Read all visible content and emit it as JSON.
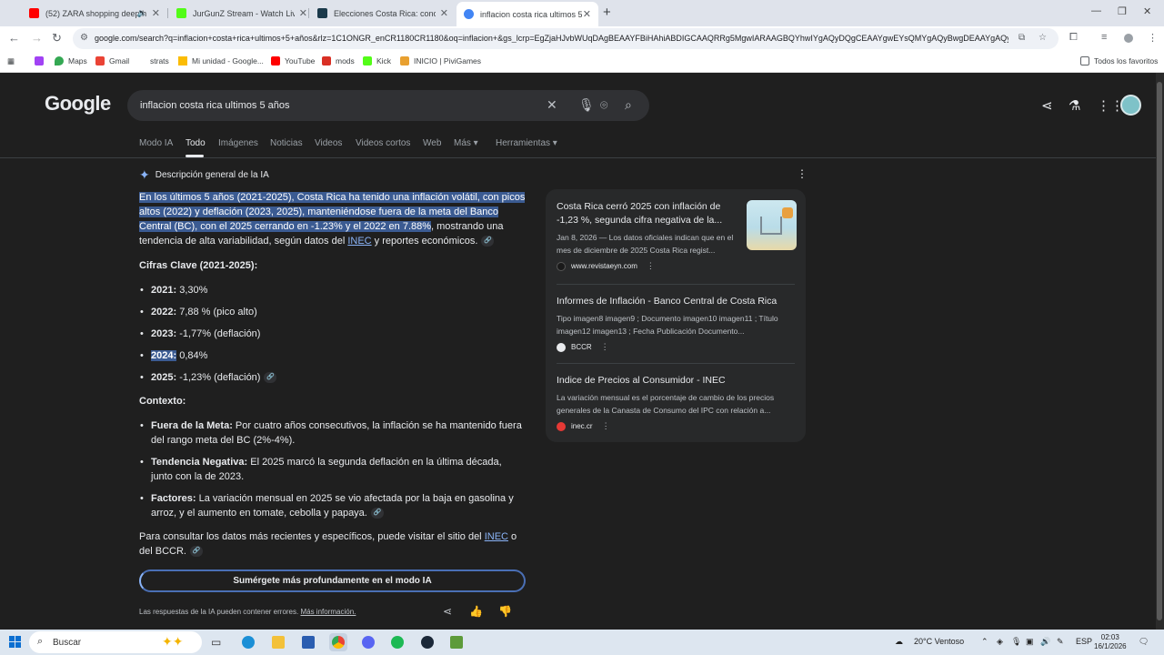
{
  "browser": {
    "tabs": [
      {
        "title": "(52) ZARA shopping deep h",
        "color": "#ff0000"
      },
      {
        "title": "JurGunZ Stream - Watch Live o",
        "color": "#53fc18"
      },
      {
        "title": "Elecciones Costa Rica: conozca",
        "color": "#1b3a4b"
      },
      {
        "title": "inflacion costa rica ultimos 5 añ",
        "color": "#4285f4"
      }
    ],
    "url": "google.com/search?q=inflacion+costa+rica+ultimos+5+años&rlz=1C1ONGR_enCR1180CR1180&oq=inflacion+&gs_lcrp=EgZjaHJvbWUqDAgBEAAYFBiHAhiABDIGCAAQRRg5MgwIARAAGBQYhwIYgAQyDQgCEAAYgwEYsQMYgAQyBwgDEAAYgAQyBwgEEAAYgAQyBwgFEAAY",
    "bookmarks": [
      "Maps",
      "Gmail",
      "strats",
      "Mi unidad - Google...",
      "YouTube",
      "mods",
      "Kick",
      "INICIO | PiviGames"
    ],
    "favorites_label": "Todos los favoritos"
  },
  "google": {
    "logo": "Google",
    "query": "inflacion costa rica ultimos 5 años",
    "tabs": [
      "Modo IA",
      "Todo",
      "Imágenes",
      "Noticias",
      "Videos",
      "Videos cortos",
      "Web",
      "Más ▾",
      "Herramientas ▾"
    ],
    "active_tab": "Todo"
  },
  "ai_overview": {
    "header": "Descripción general de la IA",
    "intro_highlight": "En los últimos 5 años (2021-2025), Costa Rica ha tenido una inflación volátil, con picos altos (2022) y deflación (2023, 2025), manteniéndose fuera de la meta del Banco Central (BC), con el 2025 cerrando en -1.23% y el 2022 en 7.88%",
    "intro_rest_1": ", mostrando una tendencia de alta variabilidad, según datos del ",
    "inec_link": "INEC",
    "intro_rest_2": " y reportes económicos.",
    "figures_title": "Cifras Clave (2021-2025):",
    "figures": [
      {
        "year": "2021:",
        "value": " 3,30%"
      },
      {
        "year": "2022:",
        "value": " 7,88 % (pico alto)"
      },
      {
        "year": "2023:",
        "value": " -1,77% (deflación)"
      },
      {
        "year": "2024:",
        "value": " 0,84%"
      },
      {
        "year": "2025:",
        "value": " -1,23% (deflación)"
      }
    ],
    "context_title": "Contexto:",
    "context": [
      {
        "label": "Fuera de la Meta:",
        "text": " Por cuatro años consecutivos, la inflación se ha mantenido fuera del rango meta del BC (2%-4%)."
      },
      {
        "label": "Tendencia Negativa:",
        "text": " El 2025 marcó la segunda deflación en la última década, junto con la de 2023."
      },
      {
        "label": "Factores:",
        "text": " La variación mensual en 2025 se vio afectada por la baja en gasolina y arroz, y el aumento en tomate, cebolla y papaya."
      }
    ],
    "footer_1": "Para consultar los datos más recientes y específicos, puede visitar el sitio del ",
    "footer_link": "INEC",
    "footer_2": " o del BCCR.",
    "deep_button": "Sumérgete más profundamente en el modo IA",
    "disclaimer": "Las respuestas de la IA pueden contener errores.",
    "more_info": "Más información."
  },
  "sources": [
    {
      "title": "Costa Rica cerró 2025 con inflación de -1,23 %, segunda cifra negativa de la...",
      "snippet": "Jan 8, 2026 — Los datos oficiales indican que en el mes de diciembre de 2025 Costa Rica regist...",
      "site": "www.revistaeyn.com",
      "fav_color": "#1a1a1a"
    },
    {
      "title": "Informes de Inflación - Banco Central de Costa Rica",
      "snippet": "Tipo imagen8 imagen9 ; Documento imagen10 imagen11 ; Título imagen12 imagen13 ; Fecha Publicación Documento...",
      "site": "BCCR",
      "fav_color": "#e8eaed"
    },
    {
      "title": "Indice de Precios al Consumidor - INEC",
      "snippet": "La variación mensual es el porcentaje de cambio de los precios generales de la Canasta de Consumo del IPC con relación a...",
      "site": "inec.cr",
      "fav_color": "#e53935"
    }
  ],
  "taskbar": {
    "search": "Buscar",
    "weather": "20°C  Ventoso",
    "lang": "ESP",
    "time": "02:03",
    "date": "16/1/2026"
  }
}
